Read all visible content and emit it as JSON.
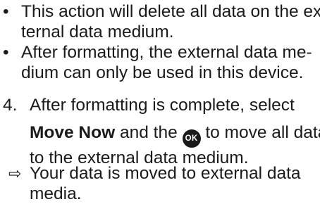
{
  "bullets": [
    {
      "marker": "•",
      "lines": [
        "This action will delete all data on the ex-",
        "ternal data medium."
      ]
    },
    {
      "marker": "•",
      "lines": [
        "After formatting, the external data me-",
        "dium can only be used in this device."
      ]
    }
  ],
  "step": {
    "number": "4.",
    "line1": "After formatting is complete, select",
    "bold_label": "Move Now",
    "mid_text": " and the ",
    "ok_icon": "OK",
    "end_text": " to move all data",
    "line3": "to the external data medium."
  },
  "result": {
    "marker": "⇨",
    "lines": [
      "Your data is moved to external data",
      "media."
    ]
  }
}
